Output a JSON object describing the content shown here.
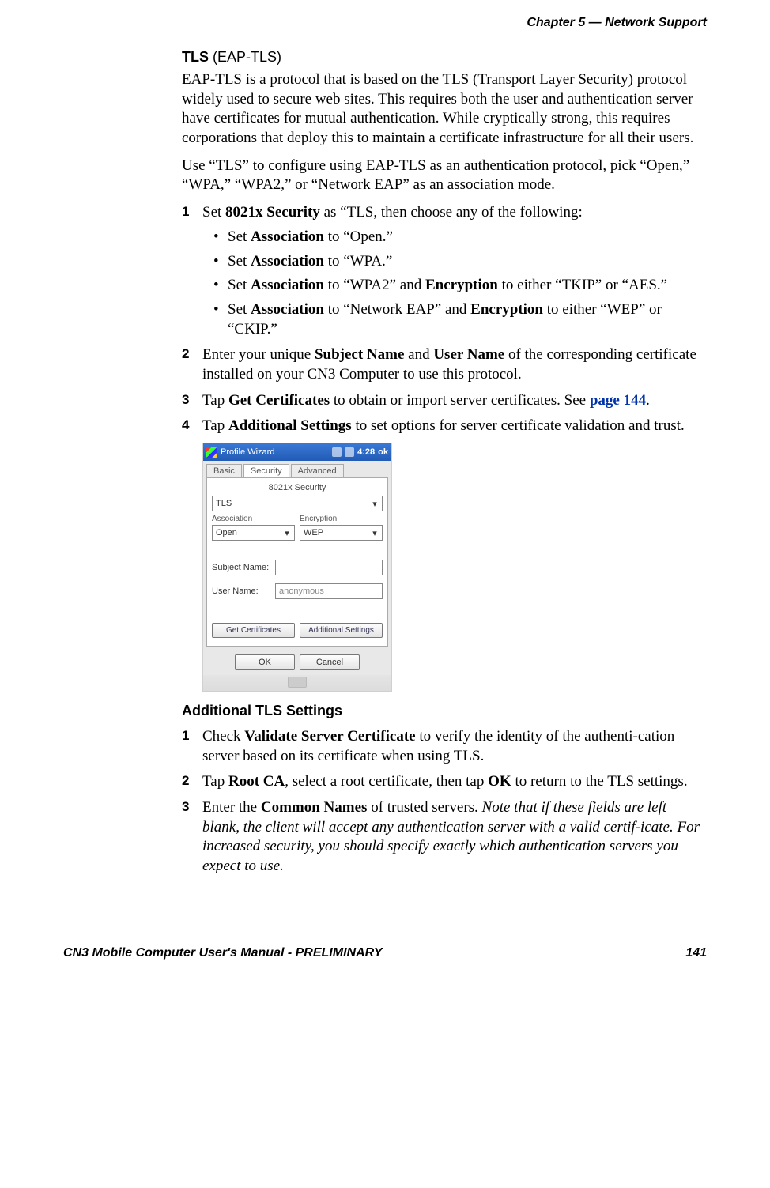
{
  "header": {
    "chapter": "Chapter 5 —  Network Support"
  },
  "section": {
    "heading_bold": "TLS",
    "heading_rest": " (EAP-TLS)",
    "para1": "EAP-TLS is a protocol that is based on the TLS (Transport Layer Security) protocol widely used to secure web sites. This requires both the user and authentication server have certificates for mutual authentication. While cryptically strong, this requires corporations that deploy this to maintain a certificate infrastructure for all their users.",
    "para2": "Use “TLS” to configure using EAP-TLS as an authentication protocol, pick “Open,” “WPA,” “WPA2,” or “Network EAP” as an association mode."
  },
  "steps": {
    "s1_num": "1",
    "s1_pre": "Set ",
    "s1_bold": "8021x Security",
    "s1_post": " as “TLS, then choose any of the following:",
    "b1_pre": "Set ",
    "b1_bold": "Association",
    "b1_post": " to “Open.”",
    "b2_pre": "Set ",
    "b2_bold": "Association",
    "b2_post": " to “WPA.”",
    "b3_pre": "Set ",
    "b3_bold1": "Association",
    "b3_mid": " to “WPA2” and ",
    "b3_bold2": "Encryption",
    "b3_post": " to either “TKIP” or “AES.”",
    "b4_pre": "Set ",
    "b4_bold1": "Association",
    "b4_mid": " to “Network EAP” and ",
    "b4_bold2": "Encryption",
    "b4_post": " to either “WEP” or “CKIP.”",
    "s2_num": "2",
    "s2_pre": "Enter your unique ",
    "s2_bold1": "Subject Name",
    "s2_mid": " and ",
    "s2_bold2": "User Name",
    "s2_post": " of the corresponding certificate installed on your CN3 Computer to use this protocol.",
    "s3_num": "3",
    "s3_pre": "Tap ",
    "s3_bold": "Get Certificates",
    "s3_mid": " to obtain or import server certificates. See ",
    "s3_link": "page 144",
    "s3_post": ".",
    "s4_num": "4",
    "s4_pre": "Tap ",
    "s4_bold": "Additional Settings",
    "s4_post": " to set options for server certificate validation and trust."
  },
  "screenshot": {
    "title": "Profile Wizard",
    "time": "4:28",
    "ok": "ok",
    "tabs": {
      "basic": "Basic",
      "security": "Security",
      "advanced": "Advanced"
    },
    "group": "8021x Security",
    "security_value": "TLS",
    "assoc_label": "Association",
    "assoc_value": "Open",
    "enc_label": "Encryption",
    "enc_value": "WEP",
    "subject_label": "Subject Name:",
    "subject_value": "",
    "user_label": "User Name:",
    "user_value": "anonymous",
    "btn_getcerts": "Get Certificates",
    "btn_additional": "Additional Settings",
    "btn_ok": "OK",
    "btn_cancel": "Cancel"
  },
  "section2": {
    "heading": "Additional TLS Settings",
    "s1_num": "1",
    "s1_pre": "Check ",
    "s1_bold": "Validate Server Certificate",
    "s1_post": " to verify the identity of the authenti-cation server based on its certificate when using TLS.",
    "s2_num": "2",
    "s2_pre": "Tap ",
    "s2_bold1": "Root CA",
    "s2_mid": ", select a root certificate, then tap ",
    "s2_bold2": "OK",
    "s2_post": " to return to the TLS settings.",
    "s3_num": "3",
    "s3_pre": "Enter the ",
    "s3_bold": "Common Names",
    "s3_mid": " of trusted servers. ",
    "s3_italic": "Note that if these fields are left blank, the client will accept any authentication server with a valid certif-icate. For increased security, you should specify exactly which authentication servers you expect to use."
  },
  "footer": {
    "left": "CN3 Mobile Computer User's Manual - PRELIMINARY",
    "right": "141"
  }
}
